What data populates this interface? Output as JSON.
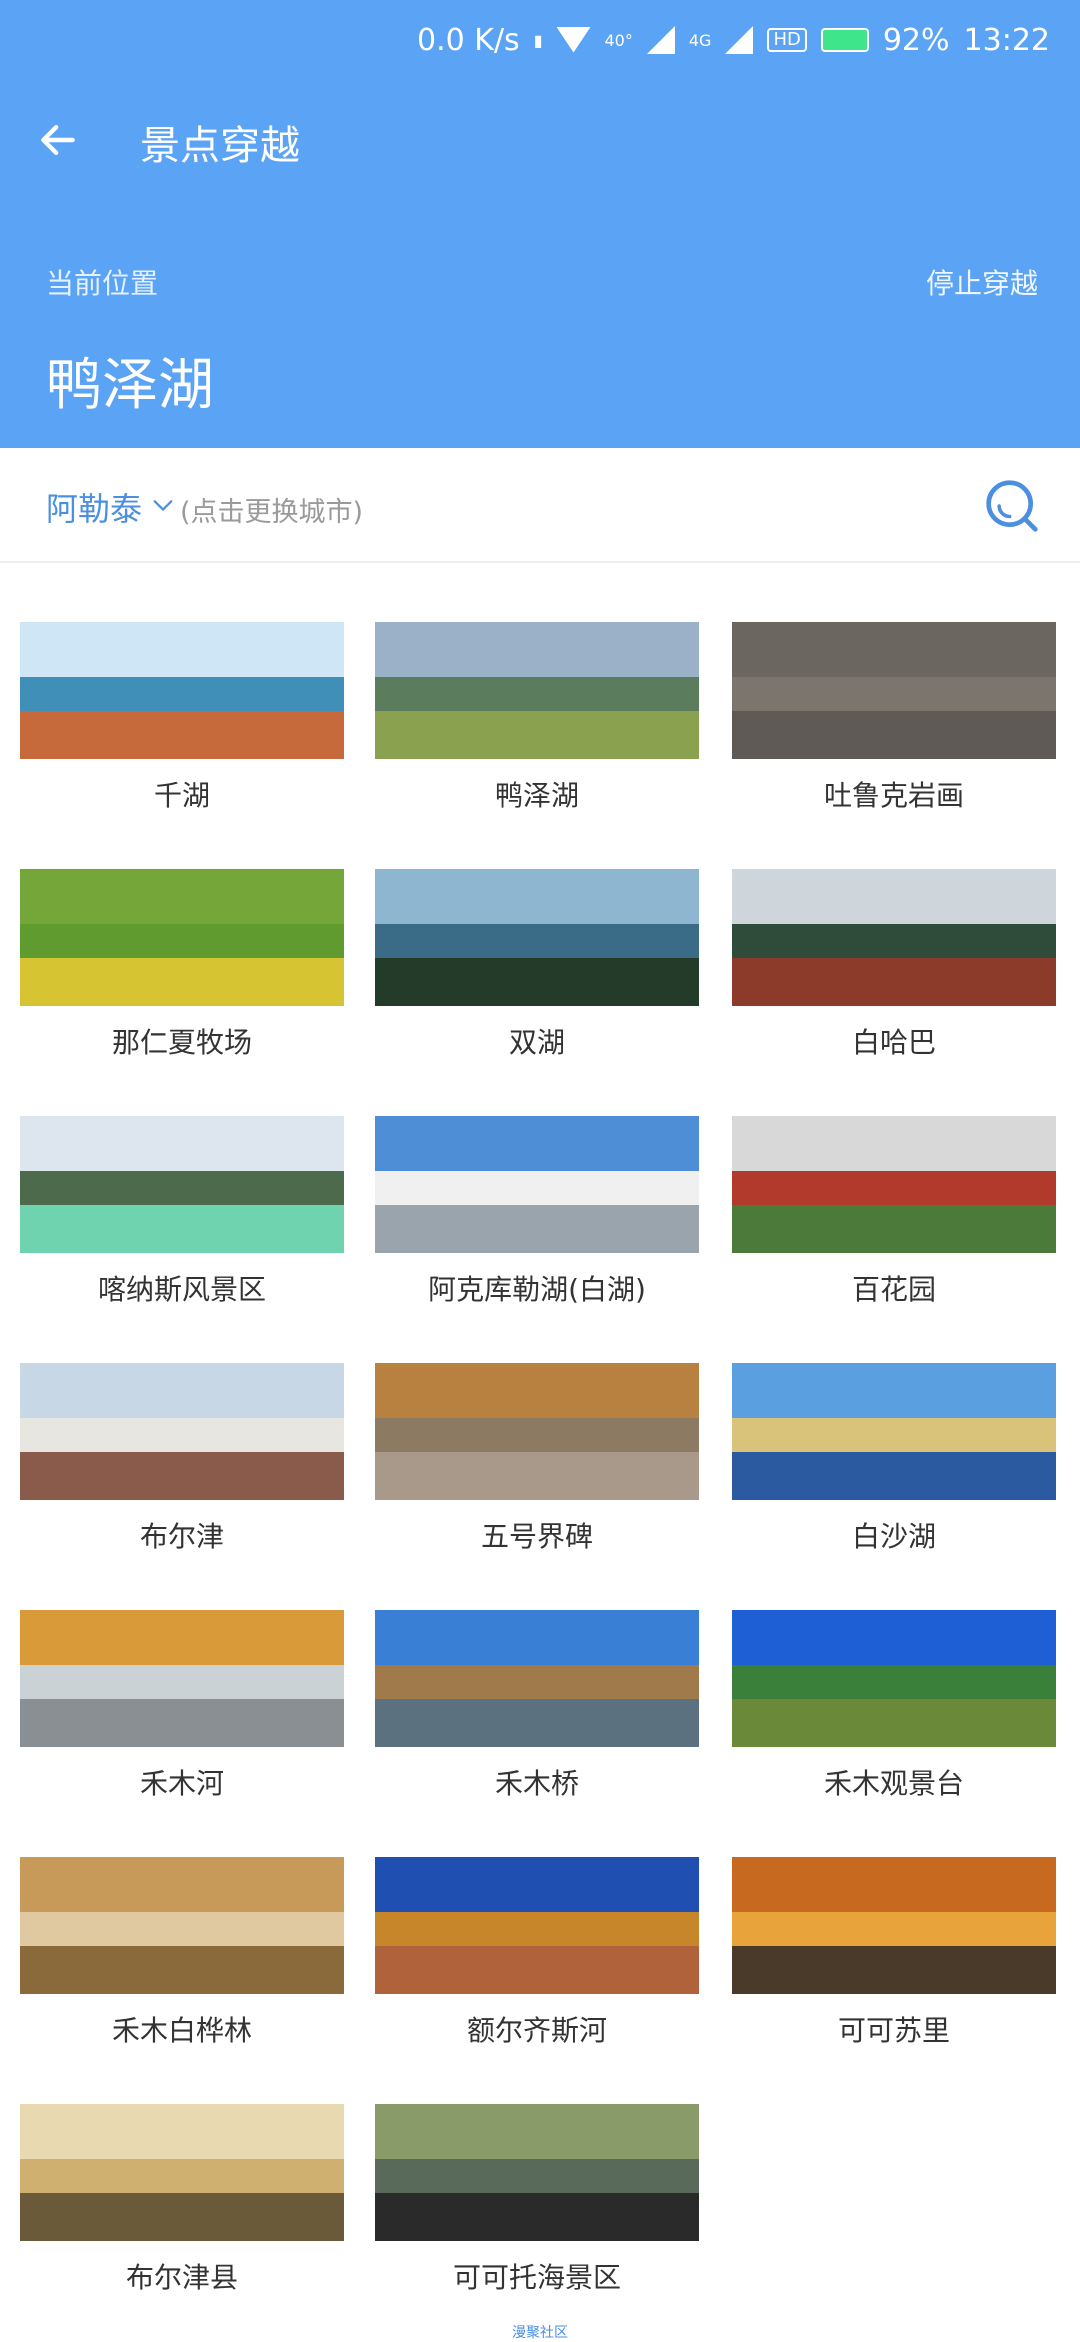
{
  "status_bar": {
    "speed": "0.0 K/s",
    "net_4g_label": "4G",
    "net_40_label": "40°",
    "hd_label": "HD",
    "battery": "92%",
    "time": "13:22"
  },
  "toolbar": {
    "title": "景点穿越"
  },
  "location": {
    "label": "当前位置",
    "value": "鸭泽湖",
    "stop_label": "停止穿越"
  },
  "city": {
    "name": "阿勒泰",
    "hint": "(点击更换城市)"
  },
  "spots": [
    {
      "name": "千湖",
      "colors": [
        "#cfe6f7",
        "#3f8fb8",
        "#c66a3b"
      ]
    },
    {
      "name": "鸭泽湖",
      "colors": [
        "#9bb1c7",
        "#5c7d5d",
        "#8aa24f"
      ]
    },
    {
      "name": "吐鲁克岩画",
      "colors": [
        "#6b6660",
        "#7b756d",
        "#5f5a55"
      ]
    },
    {
      "name": "那仁夏牧场",
      "colors": [
        "#74a63a",
        "#5f9b2f",
        "#d6c433"
      ]
    },
    {
      "name": "双湖",
      "colors": [
        "#8fb6d1",
        "#3a6b87",
        "#243b2a"
      ]
    },
    {
      "name": "白哈巴",
      "colors": [
        "#cfd6db",
        "#2f4b3a",
        "#8c3a2a"
      ]
    },
    {
      "name": "喀纳斯风景区",
      "colors": [
        "#dde6ee",
        "#4d6b4c",
        "#6fd3b0"
      ]
    },
    {
      "name": "阿克库勒湖(白湖)",
      "colors": [
        "#4e8ed6",
        "#f0f0f0",
        "#9aa4ad"
      ]
    },
    {
      "name": "百花园",
      "colors": [
        "#d8d8d8",
        "#b23a2c",
        "#4c7a3a"
      ]
    },
    {
      "name": "布尔津",
      "colors": [
        "#c7d7e6",
        "#e8e6e1",
        "#8a5a4a"
      ]
    },
    {
      "name": "五号界碑",
      "colors": [
        "#b8813f",
        "#8d7a63",
        "#a8998a"
      ]
    },
    {
      "name": "白沙湖",
      "colors": [
        "#5aa0e0",
        "#d9c27a",
        "#2c5aa0"
      ]
    },
    {
      "name": "禾木河",
      "colors": [
        "#d99a3a",
        "#cbd2d6",
        "#8a8f93"
      ]
    },
    {
      "name": "禾木桥",
      "colors": [
        "#3a7fd6",
        "#a07a4a",
        "#5b7180"
      ]
    },
    {
      "name": "禾木观景台",
      "colors": [
        "#1f5fd6",
        "#3a7f3a",
        "#6a8a3a"
      ]
    },
    {
      "name": "禾木白桦林",
      "colors": [
        "#c79a5a",
        "#e0c8a0",
        "#8a6a3a"
      ]
    },
    {
      "name": "额尔齐斯河",
      "colors": [
        "#1f4fb0",
        "#c7862a",
        "#b0623a"
      ]
    },
    {
      "name": "可可苏里",
      "colors": [
        "#c76a1f",
        "#e8a33a",
        "#4a3a2a"
      ]
    },
    {
      "name": "布尔津县",
      "colors": [
        "#e8d9b0",
        "#d0b070",
        "#6a5a3a"
      ]
    },
    {
      "name": "可可托海景区",
      "colors": [
        "#8a9b6a",
        "#5a6a5a",
        "#2a2a2a"
      ]
    }
  ],
  "footer": {
    "tag": "漫聚社区"
  }
}
